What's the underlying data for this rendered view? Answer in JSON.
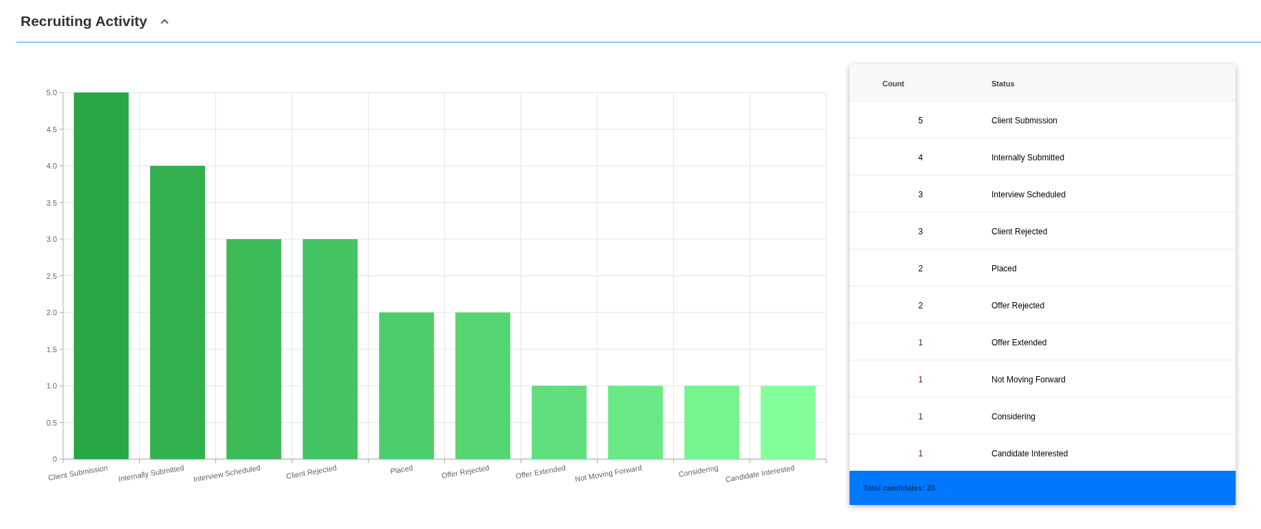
{
  "section": {
    "title": "Recruiting Activity",
    "expanded": true
  },
  "chart": {
    "chart_data": {
      "type": "bar",
      "categories": [
        "Client Submission",
        "Internally Submitted",
        "Interview Scheduled",
        "Client Rejected",
        "Placed",
        "Offer Rejected",
        "Offer Extended",
        "Not Moving Forward",
        "Considering",
        "Candidate Interested"
      ],
      "series": [
        {
          "values": [
            5,
            4,
            3,
            3,
            2,
            2,
            1,
            1,
            1,
            1
          ],
          "colors": [
            "#28a745",
            "#33b14f",
            "#3bba57",
            "#43c362",
            "#4ccd6b",
            "#55d673",
            "#5fe07d",
            "#69e986",
            "#75f48f",
            "#82fe9b"
          ]
        }
      ],
      "grid": true,
      "ylim": [
        0,
        5
      ],
      "yticks": [
        {
          "value": 0,
          "label": "0"
        },
        {
          "value": 0.5,
          "label": "0.5"
        },
        {
          "value": 1,
          "label": "1.0"
        },
        {
          "value": 1.5,
          "label": "1.5"
        },
        {
          "value": 2,
          "label": "2.0"
        },
        {
          "value": 2.5,
          "label": "2.5"
        },
        {
          "value": 3,
          "label": "3.0"
        },
        {
          "value": 3.5,
          "label": "3.5"
        },
        {
          "value": 4,
          "label": "4.0"
        },
        {
          "value": 4.5,
          "label": "4.5"
        },
        {
          "value": 5,
          "label": "5.0"
        }
      ]
    }
  },
  "table": {
    "columns": [
      "Count",
      "Status"
    ],
    "rows": [
      {
        "count": "5",
        "status": "Client Submission",
        "color": "#000000"
      },
      {
        "count": "4",
        "status": "Internally Submitted",
        "color": "#000000"
      },
      {
        "count": "3",
        "status": "Interview Scheduled",
        "color": "#000000"
      },
      {
        "count": "3",
        "status": "Client Rejected",
        "color": "#000000"
      },
      {
        "count": "2",
        "status": "Placed",
        "color": "#000000"
      },
      {
        "count": "2",
        "status": "Offer Rejected",
        "color": "#000000"
      },
      {
        "count": "1",
        "status": "Offer Extended",
        "color": "#6b0f1a"
      },
      {
        "count": "1",
        "status": "Not Moving Forward",
        "color": "#6b0f1a"
      },
      {
        "count": "1",
        "status": "Considering",
        "color": "#6b0f1a"
      },
      {
        "count": "1",
        "status": "Candidate Interested",
        "color": "#6b0f1a"
      }
    ],
    "footer": "Total candidates: 23"
  }
}
